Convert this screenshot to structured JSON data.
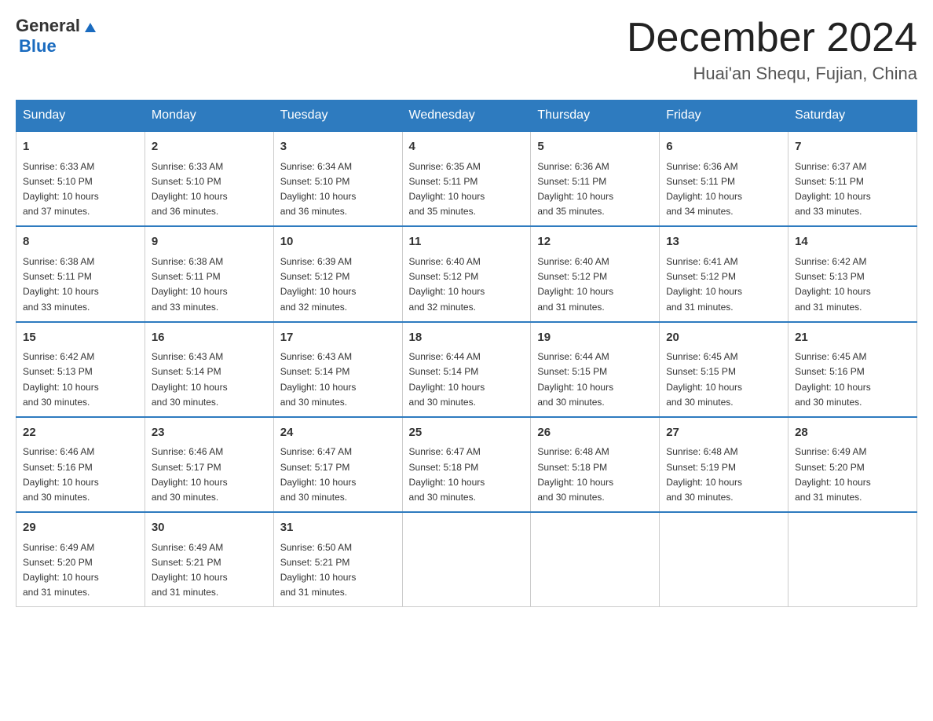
{
  "logo": {
    "general": "General",
    "blue": "Blue"
  },
  "title": "December 2024",
  "subtitle": "Huai'an Shequ, Fujian, China",
  "days_of_week": [
    "Sunday",
    "Monday",
    "Tuesday",
    "Wednesday",
    "Thursday",
    "Friday",
    "Saturday"
  ],
  "weeks": [
    [
      {
        "day": "1",
        "sunrise": "6:33 AM",
        "sunset": "5:10 PM",
        "daylight": "10 hours and 37 minutes."
      },
      {
        "day": "2",
        "sunrise": "6:33 AM",
        "sunset": "5:10 PM",
        "daylight": "10 hours and 36 minutes."
      },
      {
        "day": "3",
        "sunrise": "6:34 AM",
        "sunset": "5:10 PM",
        "daylight": "10 hours and 36 minutes."
      },
      {
        "day": "4",
        "sunrise": "6:35 AM",
        "sunset": "5:11 PM",
        "daylight": "10 hours and 35 minutes."
      },
      {
        "day": "5",
        "sunrise": "6:36 AM",
        "sunset": "5:11 PM",
        "daylight": "10 hours and 35 minutes."
      },
      {
        "day": "6",
        "sunrise": "6:36 AM",
        "sunset": "5:11 PM",
        "daylight": "10 hours and 34 minutes."
      },
      {
        "day": "7",
        "sunrise": "6:37 AM",
        "sunset": "5:11 PM",
        "daylight": "10 hours and 33 minutes."
      }
    ],
    [
      {
        "day": "8",
        "sunrise": "6:38 AM",
        "sunset": "5:11 PM",
        "daylight": "10 hours and 33 minutes."
      },
      {
        "day": "9",
        "sunrise": "6:38 AM",
        "sunset": "5:11 PM",
        "daylight": "10 hours and 33 minutes."
      },
      {
        "day": "10",
        "sunrise": "6:39 AM",
        "sunset": "5:12 PM",
        "daylight": "10 hours and 32 minutes."
      },
      {
        "day": "11",
        "sunrise": "6:40 AM",
        "sunset": "5:12 PM",
        "daylight": "10 hours and 32 minutes."
      },
      {
        "day": "12",
        "sunrise": "6:40 AM",
        "sunset": "5:12 PM",
        "daylight": "10 hours and 31 minutes."
      },
      {
        "day": "13",
        "sunrise": "6:41 AM",
        "sunset": "5:12 PM",
        "daylight": "10 hours and 31 minutes."
      },
      {
        "day": "14",
        "sunrise": "6:42 AM",
        "sunset": "5:13 PM",
        "daylight": "10 hours and 31 minutes."
      }
    ],
    [
      {
        "day": "15",
        "sunrise": "6:42 AM",
        "sunset": "5:13 PM",
        "daylight": "10 hours and 30 minutes."
      },
      {
        "day": "16",
        "sunrise": "6:43 AM",
        "sunset": "5:14 PM",
        "daylight": "10 hours and 30 minutes."
      },
      {
        "day": "17",
        "sunrise": "6:43 AM",
        "sunset": "5:14 PM",
        "daylight": "10 hours and 30 minutes."
      },
      {
        "day": "18",
        "sunrise": "6:44 AM",
        "sunset": "5:14 PM",
        "daylight": "10 hours and 30 minutes."
      },
      {
        "day": "19",
        "sunrise": "6:44 AM",
        "sunset": "5:15 PM",
        "daylight": "10 hours and 30 minutes."
      },
      {
        "day": "20",
        "sunrise": "6:45 AM",
        "sunset": "5:15 PM",
        "daylight": "10 hours and 30 minutes."
      },
      {
        "day": "21",
        "sunrise": "6:45 AM",
        "sunset": "5:16 PM",
        "daylight": "10 hours and 30 minutes."
      }
    ],
    [
      {
        "day": "22",
        "sunrise": "6:46 AM",
        "sunset": "5:16 PM",
        "daylight": "10 hours and 30 minutes."
      },
      {
        "day": "23",
        "sunrise": "6:46 AM",
        "sunset": "5:17 PM",
        "daylight": "10 hours and 30 minutes."
      },
      {
        "day": "24",
        "sunrise": "6:47 AM",
        "sunset": "5:17 PM",
        "daylight": "10 hours and 30 minutes."
      },
      {
        "day": "25",
        "sunrise": "6:47 AM",
        "sunset": "5:18 PM",
        "daylight": "10 hours and 30 minutes."
      },
      {
        "day": "26",
        "sunrise": "6:48 AM",
        "sunset": "5:18 PM",
        "daylight": "10 hours and 30 minutes."
      },
      {
        "day": "27",
        "sunrise": "6:48 AM",
        "sunset": "5:19 PM",
        "daylight": "10 hours and 30 minutes."
      },
      {
        "day": "28",
        "sunrise": "6:49 AM",
        "sunset": "5:20 PM",
        "daylight": "10 hours and 31 minutes."
      }
    ],
    [
      {
        "day": "29",
        "sunrise": "6:49 AM",
        "sunset": "5:20 PM",
        "daylight": "10 hours and 31 minutes."
      },
      {
        "day": "30",
        "sunrise": "6:49 AM",
        "sunset": "5:21 PM",
        "daylight": "10 hours and 31 minutes."
      },
      {
        "day": "31",
        "sunrise": "6:50 AM",
        "sunset": "5:21 PM",
        "daylight": "10 hours and 31 minutes."
      },
      null,
      null,
      null,
      null
    ]
  ],
  "labels": {
    "sunrise": "Sunrise:",
    "sunset": "Sunset:",
    "daylight": "Daylight:"
  }
}
